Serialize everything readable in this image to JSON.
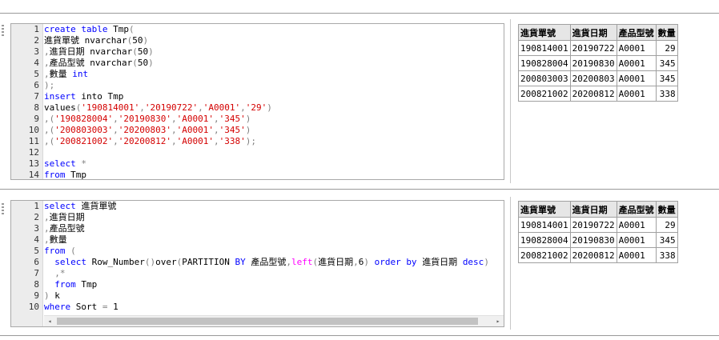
{
  "editors": [
    {
      "lines": [
        {
          "n": "1",
          "tokens": [
            [
              "kw",
              "create table "
            ],
            [
              "pl",
              "Tmp"
            ],
            [
              "gr",
              "("
            ]
          ]
        },
        {
          "n": "2",
          "tokens": [
            [
              "pl",
              "進貨單號 nvarchar"
            ],
            [
              "gr",
              "("
            ],
            [
              "pl",
              "50"
            ],
            [
              "gr",
              ")"
            ]
          ]
        },
        {
          "n": "3",
          "tokens": [
            [
              "gr",
              ","
            ],
            [
              "pl",
              "進貨日期 nvarchar"
            ],
            [
              "gr",
              "("
            ],
            [
              "pl",
              "50"
            ],
            [
              "gr",
              ")"
            ]
          ]
        },
        {
          "n": "4",
          "tokens": [
            [
              "gr",
              ","
            ],
            [
              "pl",
              "產品型號 nvarchar"
            ],
            [
              "gr",
              "("
            ],
            [
              "pl",
              "50"
            ],
            [
              "gr",
              ")"
            ]
          ]
        },
        {
          "n": "5",
          "tokens": [
            [
              "gr",
              ","
            ],
            [
              "pl",
              "數量 "
            ],
            [
              "kw",
              "int"
            ]
          ]
        },
        {
          "n": "6",
          "tokens": [
            [
              "gr",
              ");"
            ]
          ]
        },
        {
          "n": "7",
          "tokens": [
            [
              "kw",
              "insert "
            ],
            [
              "pl",
              "into Tmp"
            ]
          ]
        },
        {
          "n": "8",
          "tokens": [
            [
              "pl",
              "values"
            ],
            [
              "gr",
              "("
            ],
            [
              "str",
              "'190814001'"
            ],
            [
              "gr",
              ","
            ],
            [
              "str",
              "'20190722'"
            ],
            [
              "gr",
              ","
            ],
            [
              "str",
              "'A0001'"
            ],
            [
              "gr",
              ","
            ],
            [
              "str",
              "'29'"
            ],
            [
              "gr",
              ")"
            ]
          ]
        },
        {
          "n": "9",
          "tokens": [
            [
              "gr",
              ",("
            ],
            [
              "str",
              "'190828004'"
            ],
            [
              "gr",
              ","
            ],
            [
              "str",
              "'20190830'"
            ],
            [
              "gr",
              ","
            ],
            [
              "str",
              "'A0001'"
            ],
            [
              "gr",
              ","
            ],
            [
              "str",
              "'345'"
            ],
            [
              "gr",
              ")"
            ]
          ]
        },
        {
          "n": "10",
          "tokens": [
            [
              "gr",
              ",("
            ],
            [
              "str",
              "'200803003'"
            ],
            [
              "gr",
              ","
            ],
            [
              "str",
              "'20200803'"
            ],
            [
              "gr",
              ","
            ],
            [
              "str",
              "'A0001'"
            ],
            [
              "gr",
              ","
            ],
            [
              "str",
              "'345'"
            ],
            [
              "gr",
              ")"
            ]
          ]
        },
        {
          "n": "11",
          "tokens": [
            [
              "gr",
              ",("
            ],
            [
              "str",
              "'200821002'"
            ],
            [
              "gr",
              ","
            ],
            [
              "str",
              "'20200812'"
            ],
            [
              "gr",
              ","
            ],
            [
              "str",
              "'A0001'"
            ],
            [
              "gr",
              ","
            ],
            [
              "str",
              "'338'"
            ],
            [
              "gr",
              ");"
            ]
          ]
        },
        {
          "n": "12",
          "tokens": []
        },
        {
          "n": "13",
          "tokens": [
            [
              "kw",
              "select "
            ],
            [
              "gr",
              "*"
            ]
          ]
        },
        {
          "n": "14",
          "tokens": [
            [
              "kw",
              "from "
            ],
            [
              "pl",
              "Tmp"
            ]
          ]
        }
      ]
    },
    {
      "lines": [
        {
          "n": "1",
          "tokens": [
            [
              "kw",
              "select "
            ],
            [
              "pl",
              "進貨單號"
            ]
          ]
        },
        {
          "n": "2",
          "tokens": [
            [
              "gr",
              ","
            ],
            [
              "pl",
              "進貨日期"
            ]
          ]
        },
        {
          "n": "3",
          "tokens": [
            [
              "gr",
              ","
            ],
            [
              "pl",
              "產品型號"
            ]
          ]
        },
        {
          "n": "4",
          "tokens": [
            [
              "gr",
              ","
            ],
            [
              "pl",
              "數量"
            ]
          ]
        },
        {
          "n": "5",
          "tokens": [
            [
              "kw",
              "from "
            ],
            [
              "gr",
              "("
            ]
          ]
        },
        {
          "n": "6",
          "tokens": [
            [
              "pl",
              "  "
            ],
            [
              "kw",
              "select "
            ],
            [
              "pl",
              "Row_Number"
            ],
            [
              "gr",
              "()"
            ],
            [
              "pl",
              "over"
            ],
            [
              "gr",
              "("
            ],
            [
              "pl",
              "PARTITION "
            ],
            [
              "kw",
              "BY "
            ],
            [
              "pl",
              "產品型號"
            ],
            [
              "gr",
              ","
            ],
            [
              "fn",
              "left"
            ],
            [
              "gr",
              "("
            ],
            [
              "pl",
              "進貨日期"
            ],
            [
              "gr",
              ","
            ],
            [
              "pl",
              "6"
            ],
            [
              "gr",
              ") "
            ],
            [
              "kw",
              "order by "
            ],
            [
              "pl",
              "進貨日期 "
            ],
            [
              "kw",
              "desc"
            ],
            [
              "gr",
              ")"
            ]
          ]
        },
        {
          "n": "7",
          "tokens": [
            [
              "pl",
              "  "
            ],
            [
              "gr",
              ",*"
            ]
          ]
        },
        {
          "n": "8",
          "tokens": [
            [
              "pl",
              "  "
            ],
            [
              "kw",
              "from "
            ],
            [
              "pl",
              "Tmp"
            ]
          ]
        },
        {
          "n": "9",
          "tokens": [
            [
              "gr",
              ") "
            ],
            [
              "pl",
              "k"
            ]
          ]
        },
        {
          "n": "10",
          "tokens": [
            [
              "kw",
              "where "
            ],
            [
              "pl",
              "Sort "
            ],
            [
              "gr",
              "= "
            ],
            [
              "pl",
              "1"
            ]
          ]
        }
      ]
    }
  ],
  "results": [
    {
      "headers": [
        "進貨單號",
        "進貨日期",
        "產品型號",
        "數量"
      ],
      "rows": [
        [
          "190814001",
          "20190722",
          "A0001",
          "29"
        ],
        [
          "190828004",
          "20190830",
          "A0001",
          "345"
        ],
        [
          "200803003",
          "20200803",
          "A0001",
          "345"
        ],
        [
          "200821002",
          "20200812",
          "A0001",
          "338"
        ]
      ]
    },
    {
      "headers": [
        "進貨單號",
        "進貨日期",
        "產品型號",
        "數量"
      ],
      "rows": [
        [
          "190814001",
          "20190722",
          "A0001",
          "29"
        ],
        [
          "190828004",
          "20190830",
          "A0001",
          "345"
        ],
        [
          "200821002",
          "20200812",
          "A0001",
          "338"
        ]
      ]
    }
  ],
  "scrollbar": {
    "left_arrow": "◂",
    "right_arrow": "▸"
  },
  "colors": {
    "keyword": "#0000ff",
    "string": "#d40000",
    "function": "#ff00ff",
    "operator": "#808080"
  }
}
